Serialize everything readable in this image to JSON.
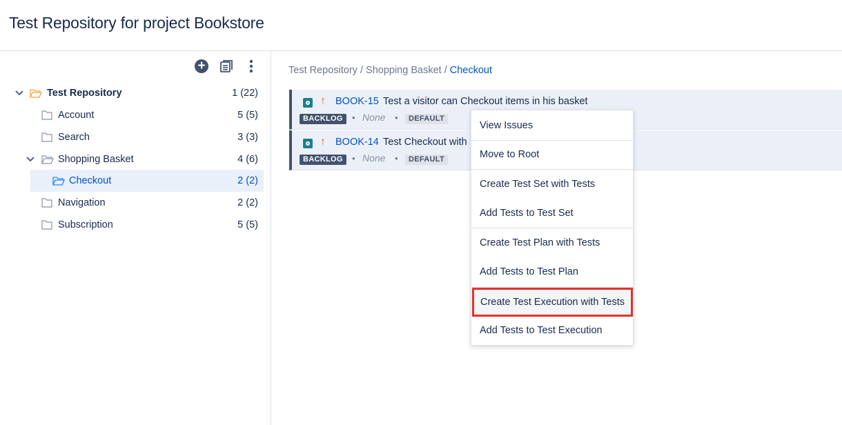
{
  "page": {
    "title": "Test Repository for project Bookstore"
  },
  "toolbar": {
    "add_icon": "plus-circle-icon",
    "view_icon": "document-list-icon",
    "more_icon": "vertical-ellipsis-icon"
  },
  "tree": {
    "root": {
      "label": "Test Repository",
      "count": "1 (22)"
    },
    "items": [
      {
        "label": "Account",
        "count": "5 (5)"
      },
      {
        "label": "Search",
        "count": "3 (3)"
      },
      {
        "label": "Shopping Basket",
        "count": "4 (6)"
      },
      {
        "label": "Checkout",
        "count": "2 (2)"
      },
      {
        "label": "Navigation",
        "count": "2 (2)"
      },
      {
        "label": "Subscription",
        "count": "5 (5)"
      }
    ]
  },
  "breadcrumb": {
    "part1": "Test Repository",
    "sep": " / ",
    "part2": "Shopping Basket",
    "current": "Checkout"
  },
  "tests": [
    {
      "key": "BOOK-15",
      "summary": "Test a visitor can Checkout items in his basket",
      "status": "BACKLOG",
      "assignee": "None",
      "environment": "DEFAULT"
    },
    {
      "key": "BOOK-14",
      "summary": "Test Checkout with",
      "status": "BACKLOG",
      "assignee": "None",
      "environment": "DEFAULT"
    }
  ],
  "meta_separator": "•",
  "context_menu": {
    "items": [
      "View Issues",
      "Move to Root",
      "Create Test Set with Tests",
      "Add Tests to Test Set",
      "Create Test Plan with Tests",
      "Add Tests to Test Plan",
      "Create Test Execution with Tests",
      "Add Tests to Test Execution"
    ],
    "highlighted_index": 6,
    "highlight_color": "#e3322b"
  },
  "colors": {
    "link": "#0052cc",
    "text": "#172b4d",
    "selected_bg": "#e9f0f9",
    "priority": "#e46c20",
    "test_icon": "#1d7f8f"
  }
}
